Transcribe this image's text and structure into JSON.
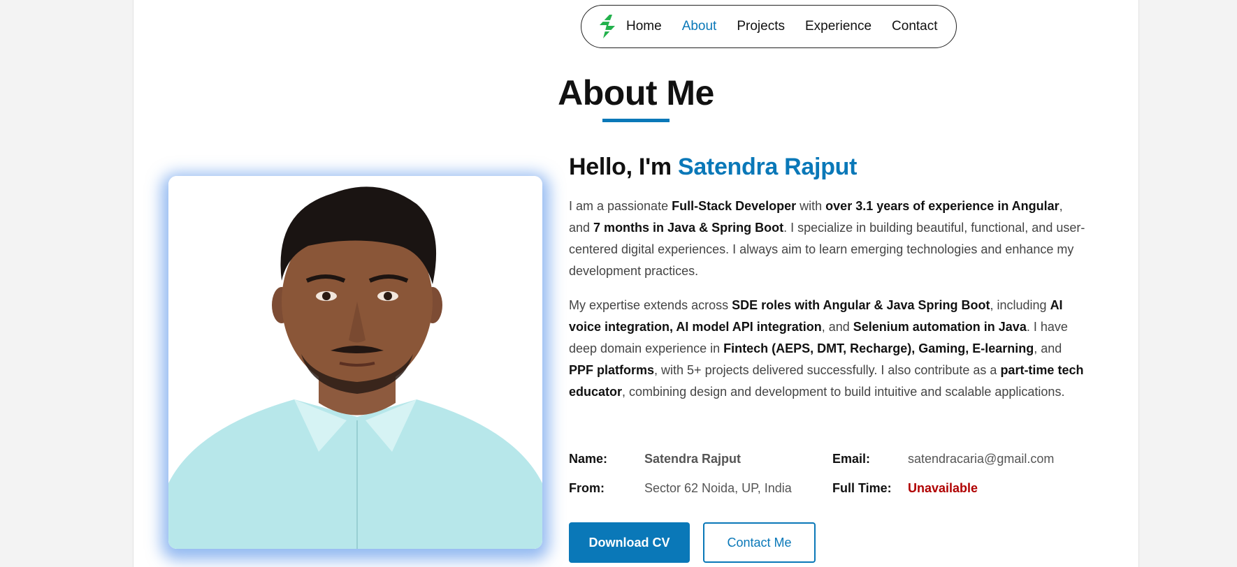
{
  "nav": {
    "items": [
      {
        "label": "Home",
        "active": false
      },
      {
        "label": "About",
        "active": true
      },
      {
        "label": "Projects",
        "active": false
      },
      {
        "label": "Experience",
        "active": false
      },
      {
        "label": "Contact",
        "active": false
      }
    ],
    "logo_icon": "lightning-logo-icon",
    "theme_icon": "sun-icon"
  },
  "section": {
    "title": "About Me"
  },
  "about": {
    "greeting_prefix": "Hello, I'm ",
    "greeting_name": "Satendra Rajput",
    "para1": [
      {
        "t": "I am a passionate ",
        "b": false
      },
      {
        "t": "Full-Stack Developer",
        "b": true
      },
      {
        "t": " with ",
        "b": false
      },
      {
        "t": "over 3.1 years of experience in Angular",
        "b": true
      },
      {
        "t": ", and ",
        "b": false
      },
      {
        "t": "7 months in Java & Spring Boot",
        "b": true
      },
      {
        "t": ". I specialize in building beautiful, functional, and user-centered digital experiences. I always aim to learn emerging technologies and enhance my development practices.",
        "b": false
      }
    ],
    "para2": [
      {
        "t": "My expertise extends across ",
        "b": false
      },
      {
        "t": "SDE roles with Angular & Java Spring Boot",
        "b": true
      },
      {
        "t": ", including ",
        "b": false
      },
      {
        "t": "AI voice integration, AI model API integration",
        "b": true
      },
      {
        "t": ", and ",
        "b": false
      },
      {
        "t": "Selenium automation in Java",
        "b": true
      },
      {
        "t": ". I have deep domain experience in ",
        "b": false
      },
      {
        "t": "Fintech (AEPS, DMT, Recharge), Gaming, E-learning",
        "b": true
      },
      {
        "t": ", and ",
        "b": false
      },
      {
        "t": "PPF platforms",
        "b": true
      },
      {
        "t": ", with 5+ projects delivered successfully. I also contribute as a ",
        "b": false
      },
      {
        "t": "part-time tech educator",
        "b": true
      },
      {
        "t": ", combining design and development to build intuitive and scalable applications.",
        "b": false
      }
    ],
    "info": {
      "name_label": "Name:",
      "name_value": "Satendra Rajput",
      "email_label": "Email:",
      "email_value": "satendracaria@gmail.com",
      "from_label": "From:",
      "from_value": "Sector 62 Noida, UP, India",
      "fulltime_label": "Full Time:",
      "fulltime_value": "Unavailable"
    },
    "buttons": {
      "download_cv": "Download CV",
      "contact_me": "Contact Me"
    }
  },
  "colors": {
    "accent": "#0a78b8",
    "unavailable": "#b00000",
    "logo_green": "#22b14c"
  }
}
